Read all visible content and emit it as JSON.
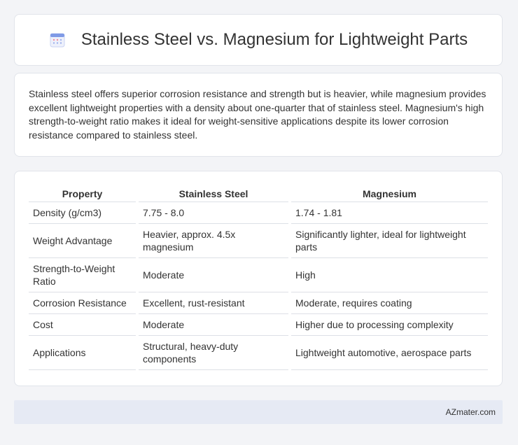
{
  "header": {
    "title": "Stainless Steel vs. Magnesium for Lightweight Parts",
    "icon": "calendar-icon"
  },
  "summary": {
    "text": "Stainless steel offers superior corrosion resistance and strength but is heavier, while magnesium provides excellent lightweight properties with a density about one-quarter that of stainless steel. Magnesium's high strength-to-weight ratio makes it ideal for weight-sensitive applications despite its lower corrosion resistance compared to stainless steel."
  },
  "table": {
    "headers": [
      "Property",
      "Stainless Steel",
      "Magnesium"
    ],
    "rows": [
      [
        "Density (g/cm3)",
        "7.75 - 8.0",
        "1.74 - 1.81"
      ],
      [
        "Weight Advantage",
        "Heavier, approx. 4.5x magnesium",
        "Significantly lighter, ideal for lightweight parts"
      ],
      [
        "Strength-to-Weight Ratio",
        "Moderate",
        "High"
      ],
      [
        "Corrosion Resistance",
        "Excellent, rust-resistant",
        "Moderate, requires coating"
      ],
      [
        "Cost",
        "Moderate",
        "Higher due to processing complexity"
      ],
      [
        "Applications",
        "Structural, heavy-duty components",
        "Lightweight automotive, aerospace parts"
      ]
    ]
  },
  "footer": {
    "text": "AZmater.com"
  },
  "colors": {
    "background": "#f3f4f7",
    "card": "#ffffff",
    "footer": "#e6eaf4",
    "icon_accent": "#6c8ee8"
  }
}
